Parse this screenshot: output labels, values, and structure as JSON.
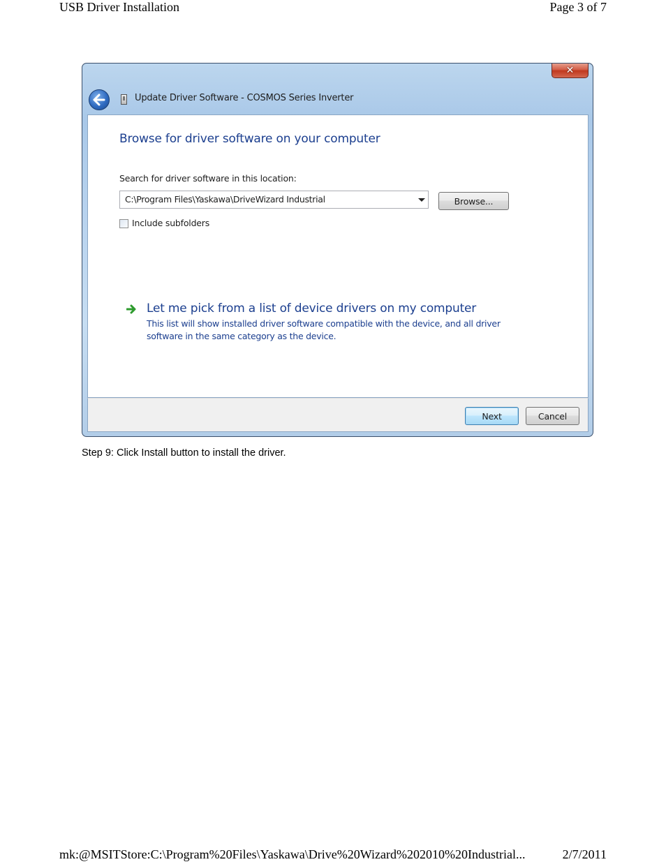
{
  "page_header": {
    "title": "USB Driver Installation",
    "page_number": "Page 3 of 7"
  },
  "dialog": {
    "title": "Update Driver Software - COSMOS Series Inverter",
    "close_label": "✕",
    "heading": "Browse for driver software on your computer",
    "search_label": "Search for driver software in this location:",
    "path_value": "C:\\Program Files\\Yaskawa\\DriveWizard Industrial",
    "browse_label": "Browse...",
    "include_subfolders_label": "Include subfolders",
    "include_subfolders_checked": false,
    "pick_title": "Let me pick from a list of device drivers on my computer",
    "pick_description": "This list will show installed driver software compatible with the device, and all driver software in the same category as the device.",
    "next_label": "Next",
    "cancel_label": "Cancel"
  },
  "caption": "Step 9: Click Install button to install the driver.",
  "page_footer": {
    "url": "mk:@MSITStore:C:\\Program%20Files\\Yaskawa\\Drive%20Wizard%202010%20Industrial...",
    "date": "2/7/2011"
  },
  "colors": {
    "link_blue": "#1c3f8f",
    "arrow_green": "#2e9b2e",
    "close_red": "#c0391f"
  }
}
